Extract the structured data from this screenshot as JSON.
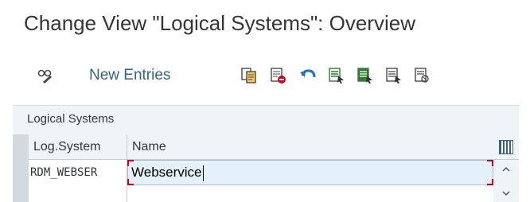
{
  "window": {
    "title": "Change View \"Logical Systems\": Overview"
  },
  "toolbar": {
    "new_entries_label": "New Entries",
    "icons": [
      "display-change-icon",
      "copy-as-icon",
      "delete-icon",
      "undo-icon",
      "select-all-icon",
      "select-block-icon",
      "deselect-all-icon",
      "print-icon"
    ]
  },
  "panel": {
    "title": "Logical Systems",
    "columns": [
      "Log.System",
      "Name"
    ],
    "rows": [
      {
        "log_system": "RDM_WEBSER",
        "name": "Webservice"
      }
    ]
  },
  "colors": {
    "accent": "#346187",
    "panel_bg": "#eff4f9",
    "selected_cell": "#e5f1fa",
    "focus_marker": "#d0021b"
  }
}
